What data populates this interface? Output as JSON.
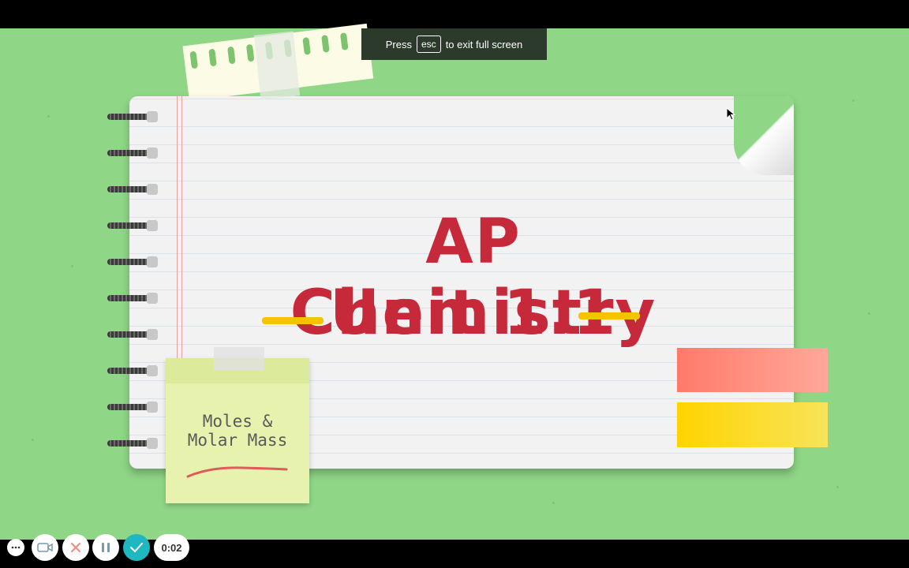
{
  "toast": {
    "prefix": "Press",
    "key": "esc",
    "suffix": "to exit full screen"
  },
  "slide": {
    "title_line1": "AP Chemistry",
    "title_line2": "Unit 1.1",
    "sticky_line1": "Moles &",
    "sticky_line2": "Molar Mass"
  },
  "controls": {
    "more_icon": "more-horizontal-icon",
    "camera_icon": "camera-switch-icon",
    "close_icon": "close-icon",
    "pause_icon": "pause-icon",
    "done_icon": "check-icon",
    "timer": "0:02"
  },
  "colors": {
    "background": "#8fd686",
    "title": "#c62a3a",
    "accent_yellow": "#f5c400",
    "done_button": "#1fb8c0"
  }
}
